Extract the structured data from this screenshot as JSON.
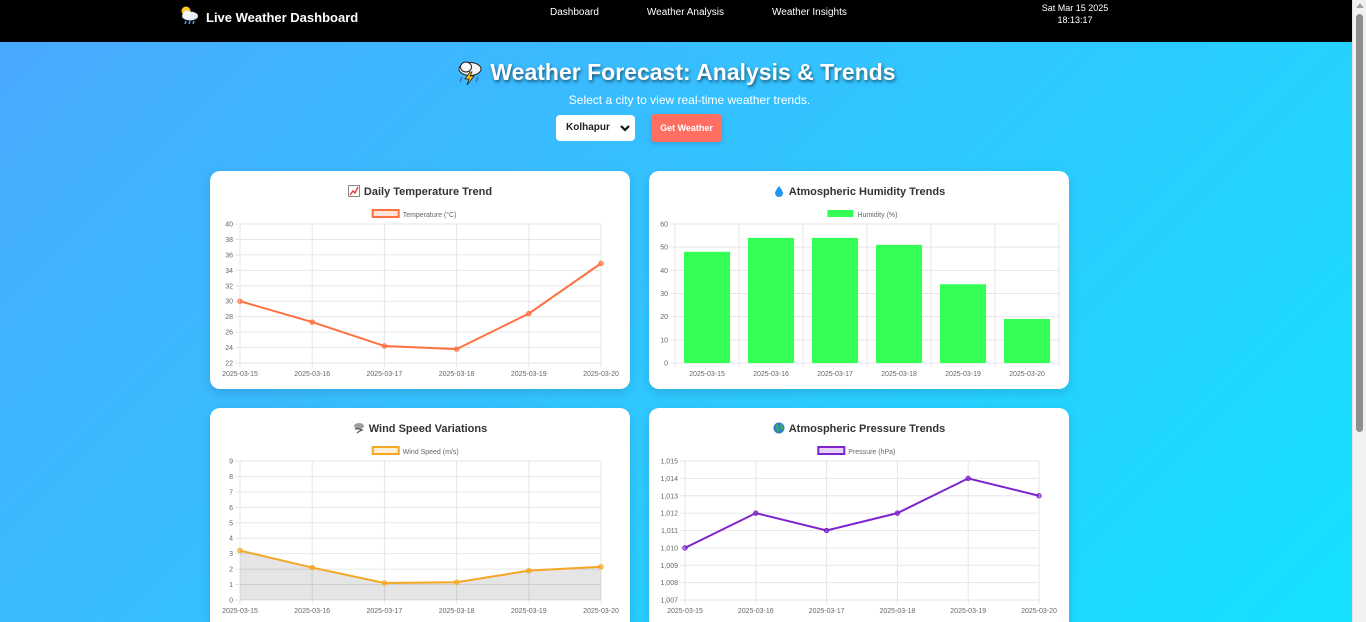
{
  "navbar": {
    "brand": "Live Weather Dashboard",
    "links": [
      "Dashboard",
      "Weather Analysis",
      "Weather Insights"
    ],
    "date": "Sat Mar 15 2025",
    "time": "18:13:17"
  },
  "hero": {
    "title": "Weather Forecast: Analysis & Trends",
    "subtitle": "Select a city to view real-time weather trends."
  },
  "controls": {
    "city": "Kolhapur",
    "button": "Get Weather"
  },
  "colors": {
    "temperature": "#ff7043",
    "humidity": "#33ff55",
    "wind": "#f5a623",
    "pressure": "#7e22ce",
    "button": "#ff6f61"
  },
  "chart_data": [
    {
      "id": "temp",
      "type": "line",
      "title": "Daily Temperature Trend",
      "icon": "chart-increasing-icon",
      "legend": "Temperature (°C)",
      "x": [
        "2025-03-15",
        "2025-03-16",
        "2025-03-17",
        "2025-03-18",
        "2025-03-19",
        "2025-03-20"
      ],
      "values": [
        30.0,
        27.3,
        24.2,
        23.8,
        28.4,
        34.9
      ],
      "ylim": [
        22,
        40
      ],
      "yticks": [
        "22",
        "24",
        "26",
        "28",
        "30",
        "32",
        "34",
        "36",
        "38",
        "40"
      ],
      "fill": false
    },
    {
      "id": "humidity",
      "type": "bar",
      "title": "Atmospheric Humidity Trends",
      "icon": "droplet-icon",
      "legend": "Humidity (%)",
      "x": [
        "2025-03-15",
        "2025-03-16",
        "2025-03-17",
        "2025-03-18",
        "2025-03-19",
        "2025-03-20"
      ],
      "values": [
        48,
        54,
        54,
        51,
        34,
        19
      ],
      "ylim": [
        0,
        60
      ],
      "yticks": [
        "0",
        "10",
        "20",
        "30",
        "40",
        "50",
        "60"
      ]
    },
    {
      "id": "wind",
      "type": "area",
      "title": "Wind Speed Variations",
      "icon": "wind-icon",
      "legend": "Wind Speed (m/s)",
      "x": [
        "2025-03-15",
        "2025-03-16",
        "2025-03-17",
        "2025-03-18",
        "2025-03-19",
        "2025-03-20"
      ],
      "values": [
        3.2,
        2.1,
        1.1,
        1.15,
        1.9,
        2.15
      ],
      "ylim": [
        0,
        9
      ],
      "yticks": [
        "0",
        "1",
        "2",
        "3",
        "4",
        "5",
        "6",
        "7",
        "8",
        "9"
      ],
      "fill": true
    },
    {
      "id": "pressure",
      "type": "line",
      "title": "Atmospheric Pressure Trends",
      "icon": "globe-icon",
      "legend": "Pressure (hPa)",
      "x": [
        "2025-03-15",
        "2025-03-16",
        "2025-03-17",
        "2025-03-18",
        "2025-03-19",
        "2025-03-20"
      ],
      "values": [
        1010,
        1012,
        1011,
        1012,
        1014,
        1013
      ],
      "ylim": [
        1007,
        1015
      ],
      "yticks": [
        "1,007",
        "1,008",
        "1,009",
        "1,010",
        "1,011",
        "1,012",
        "1,013",
        "1,014",
        "1,015"
      ],
      "fill": false
    }
  ]
}
